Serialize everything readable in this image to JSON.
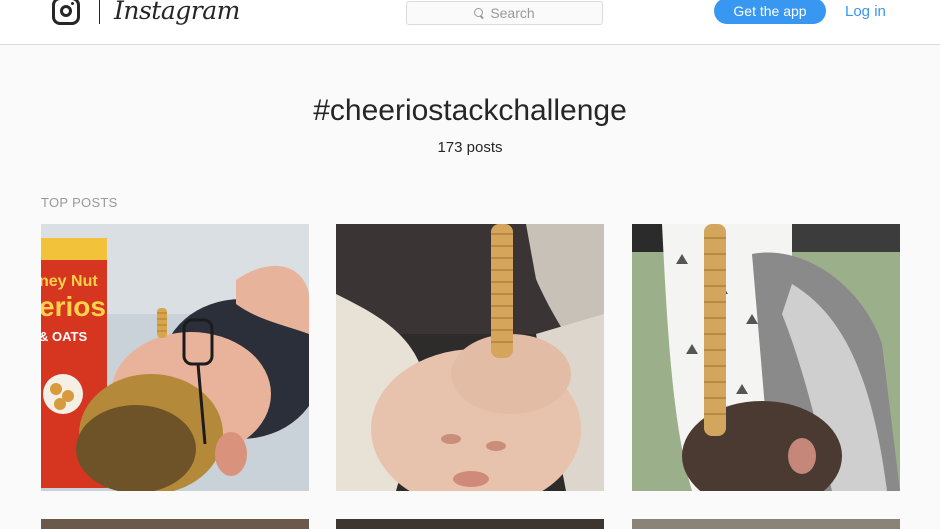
{
  "header": {
    "logo_icon": "instagram-glyph-icon",
    "wordmark": "Instagram",
    "search_placeholder": "Search",
    "search_icon": "search-icon",
    "get_app_label": "Get the app",
    "login_label": "Log in"
  },
  "hashtag": {
    "title": "#cheeriostackchallenge",
    "post_count": "173 posts"
  },
  "top_posts": {
    "label": "TOP POSTS",
    "tile_1_box_text": [
      "ney Nut",
      "erios",
      "& OATS"
    ]
  },
  "colors": {
    "accent": "#3897f0",
    "text": "#262626",
    "muted": "#999999"
  }
}
